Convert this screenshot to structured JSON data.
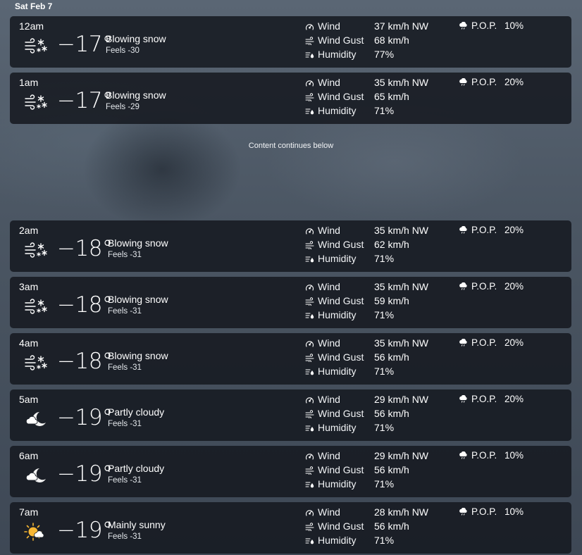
{
  "date_label": "Sat Feb 7",
  "gap_note": "Content continues below",
  "labels": {
    "wind": "Wind",
    "wind_gust": "Wind Gust",
    "humidity": "Humidity",
    "pop": "P.O.P."
  },
  "icon_names": {
    "wind": "wind-gauge-icon",
    "wind_gust": "wind-gust-icon",
    "humidity": "humidity-icon",
    "pop": "rain-cloud-icon"
  },
  "hours": [
    {
      "time": "12am",
      "icon": "blowing-snow-icon",
      "temp": "−17°",
      "condition": "Blowing snow",
      "feels": "Feels -30",
      "wind": "37 km/h NW",
      "gust": "68 km/h",
      "humidity": "77%",
      "pop": "10%"
    },
    {
      "time": "1am",
      "icon": "blowing-snow-icon",
      "temp": "−17°",
      "condition": "Blowing snow",
      "feels": "Feels -29",
      "wind": "35 km/h NW",
      "gust": "65 km/h",
      "humidity": "71%",
      "pop": "20%"
    },
    {
      "time": "2am",
      "icon": "blowing-snow-icon",
      "temp": "−18°",
      "condition": "Blowing snow",
      "feels": "Feels -31",
      "wind": "35 km/h NW",
      "gust": "62 km/h",
      "humidity": "71%",
      "pop": "20%"
    },
    {
      "time": "3am",
      "icon": "blowing-snow-icon",
      "temp": "−18°",
      "condition": "Blowing snow",
      "feels": "Feels -31",
      "wind": "35 km/h NW",
      "gust": "59 km/h",
      "humidity": "71%",
      "pop": "20%"
    },
    {
      "time": "4am",
      "icon": "blowing-snow-icon",
      "temp": "−18°",
      "condition": "Blowing snow",
      "feels": "Feels -31",
      "wind": "35 km/h NW",
      "gust": "56 km/h",
      "humidity": "71%",
      "pop": "20%"
    },
    {
      "time": "5am",
      "icon": "partly-cloudy-night-icon",
      "temp": "−19°",
      "condition": "Partly cloudy",
      "feels": "Feels -31",
      "wind": "29 km/h NW",
      "gust": "56 km/h",
      "humidity": "71%",
      "pop": "20%"
    },
    {
      "time": "6am",
      "icon": "partly-cloudy-night-icon",
      "temp": "−19°",
      "condition": "Partly cloudy",
      "feels": "Feels -31",
      "wind": "29 km/h NW",
      "gust": "56 km/h",
      "humidity": "71%",
      "pop": "10%"
    },
    {
      "time": "7am",
      "icon": "mainly-sunny-icon",
      "temp": "−19°",
      "condition": "Mainly sunny",
      "feels": "Feels -31",
      "wind": "28 km/h NW",
      "gust": "56 km/h",
      "humidity": "71%",
      "pop": "10%"
    }
  ]
}
